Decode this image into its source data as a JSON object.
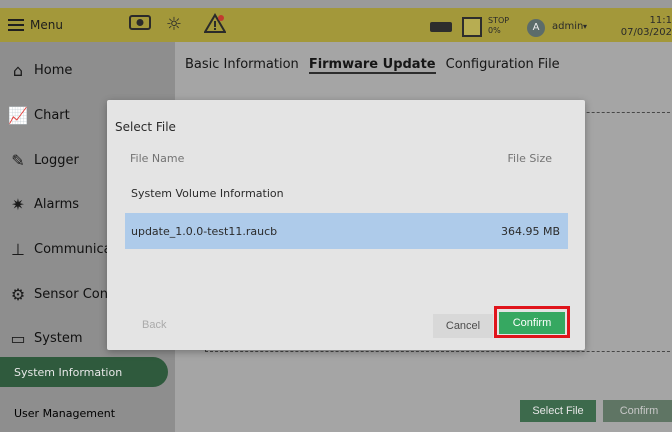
{
  "topbar": {
    "menu_label": "Menu",
    "icons": [
      "camera-icon",
      "brightness-icon",
      "alert-icon",
      "storage-icon",
      "stop-icon"
    ],
    "stop_label": "STOP",
    "stop_percent": "0%",
    "user_initial": "A",
    "user_name": "admin",
    "time": "11:1",
    "date": "07/03/202"
  },
  "sidebar": {
    "items": [
      {
        "label": "Home",
        "icon": "home-icon"
      },
      {
        "label": "Chart",
        "icon": "chart-icon"
      },
      {
        "label": "Logger",
        "icon": "logger-icon"
      },
      {
        "label": "Alarms",
        "icon": "alarm-icon"
      },
      {
        "label": "Communica",
        "icon": "network-icon"
      },
      {
        "label": "Sensor Con",
        "icon": "sensor-gear-icon"
      },
      {
        "label": "System",
        "icon": "monitor-icon"
      }
    ],
    "sub_items": [
      {
        "label": "System Information",
        "active": true
      },
      {
        "label": "User Management",
        "active": false
      }
    ]
  },
  "main": {
    "tabs": [
      {
        "label": "Basic Information",
        "active": false
      },
      {
        "label": "Firmware Update",
        "active": true
      },
      {
        "label": "Configuration File",
        "active": false
      }
    ],
    "select_file_button": "Select File",
    "confirm_button": "Confirm"
  },
  "dialog": {
    "title": "Select File",
    "columns": {
      "name": "File Name",
      "size": "File Size"
    },
    "files": [
      {
        "name": "System Volume Information",
        "size": "",
        "selected": false
      },
      {
        "name": "update_1.0.0-test11.raucb",
        "size": "364.95 MB",
        "selected": true
      }
    ],
    "back_label": "Back",
    "cancel_label": "Cancel",
    "confirm_label": "Confirm"
  },
  "colors": {
    "topbar": "#a3983a",
    "confirm_green": "#36a861",
    "selected_row": "#aecbea",
    "highlight_red": "#e0141b"
  }
}
